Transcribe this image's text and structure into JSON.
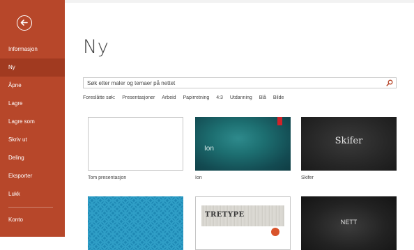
{
  "sidebar": {
    "back_icon": "arrow-left-circle-icon",
    "items": [
      {
        "label": "Informasjon"
      },
      {
        "label": "Ny"
      },
      {
        "label": "Åpne"
      },
      {
        "label": "Lagre"
      },
      {
        "label": "Lagre som"
      },
      {
        "label": "Skriv ut"
      },
      {
        "label": "Deling"
      },
      {
        "label": "Eksporter"
      },
      {
        "label": "Lukk"
      }
    ],
    "bottom_items": [
      {
        "label": "Konto"
      }
    ],
    "active": "Ny",
    "color": "#b7472a",
    "active_color": "#a13a20"
  },
  "main": {
    "title": "Ny",
    "search": {
      "placeholder": "Søk etter maler og temaer på nettet",
      "icon": "search-icon",
      "icon_color": "#b7472a"
    },
    "suggested": {
      "label": "Foreslåtte søk:",
      "items": [
        "Presentasjoner",
        "Arbeid",
        "Papirretning",
        "4:3",
        "Utdanning",
        "Blå",
        "Bilde"
      ]
    },
    "templates": [
      {
        "label": "Tom presentasjon"
      },
      {
        "label": "Ion",
        "thumb_text": "Ion"
      },
      {
        "label": "Skifer",
        "thumb_text": "Skifer"
      },
      {
        "label": ""
      },
      {
        "label": "",
        "thumb_text": "TRETYPE"
      },
      {
        "label": "",
        "thumb_text": "NETT"
      }
    ]
  }
}
